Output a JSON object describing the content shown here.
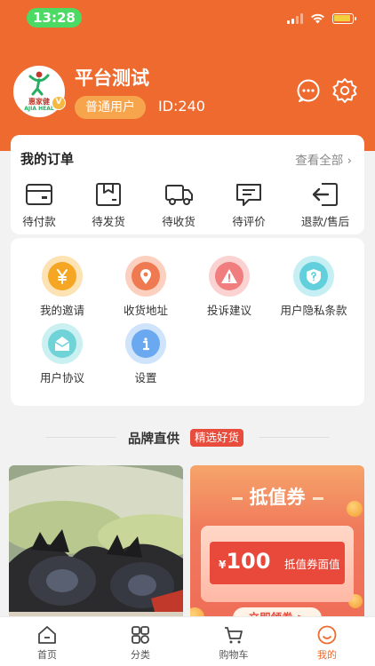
{
  "status_bar": {
    "time": "13:28"
  },
  "profile": {
    "username": "平台测试",
    "user_type": "普通用户",
    "user_id": "ID:240",
    "avatar_logo_text": "惠家健",
    "avatar_logo_sub": "AJIA HEAL",
    "vip_badge": "V"
  },
  "orders": {
    "title": "我的订单",
    "view_all": "查看全部",
    "items": [
      {
        "label": "待付款",
        "icon": "wallet-icon"
      },
      {
        "label": "待发货",
        "icon": "package-icon"
      },
      {
        "label": "待收货",
        "icon": "truck-icon"
      },
      {
        "label": "待评价",
        "icon": "comment-icon"
      },
      {
        "label": "退款/售后",
        "icon": "return-icon"
      }
    ]
  },
  "services": {
    "items": [
      {
        "label": "我的邀请",
        "icon": "yen-icon",
        "color": "#f5a623"
      },
      {
        "label": "收货地址",
        "icon": "location-pin-icon",
        "color": "#ef7a52"
      },
      {
        "label": "投诉建议",
        "icon": "warning-icon",
        "color": "#f07e7e"
      },
      {
        "label": "用户隐私条款",
        "icon": "question-icon",
        "color": "#62d0dc"
      },
      {
        "label": "用户协议",
        "icon": "mail-open-icon",
        "color": "#6fd3d7"
      },
      {
        "label": "设置",
        "icon": "info-icon",
        "color": "#6aa9f0"
      }
    ]
  },
  "brand": {
    "title": "品牌直供",
    "tag": "精选好货"
  },
  "coupon": {
    "title": "抵值券",
    "currency": "¥",
    "amount": "100",
    "subtitle": "抵值券面值",
    "button": "立即领券 >"
  },
  "tabbar": {
    "items": [
      {
        "label": "首页",
        "icon": "home-icon"
      },
      {
        "label": "分类",
        "icon": "grid-icon"
      },
      {
        "label": "购物车",
        "icon": "cart-icon"
      },
      {
        "label": "我的",
        "icon": "profile-icon"
      }
    ],
    "active_index": 3
  },
  "colors": {
    "brand_orange": "#ee6a2f",
    "user_type_bg": "#f6a54c",
    "tag_red": "#e74c3c"
  }
}
